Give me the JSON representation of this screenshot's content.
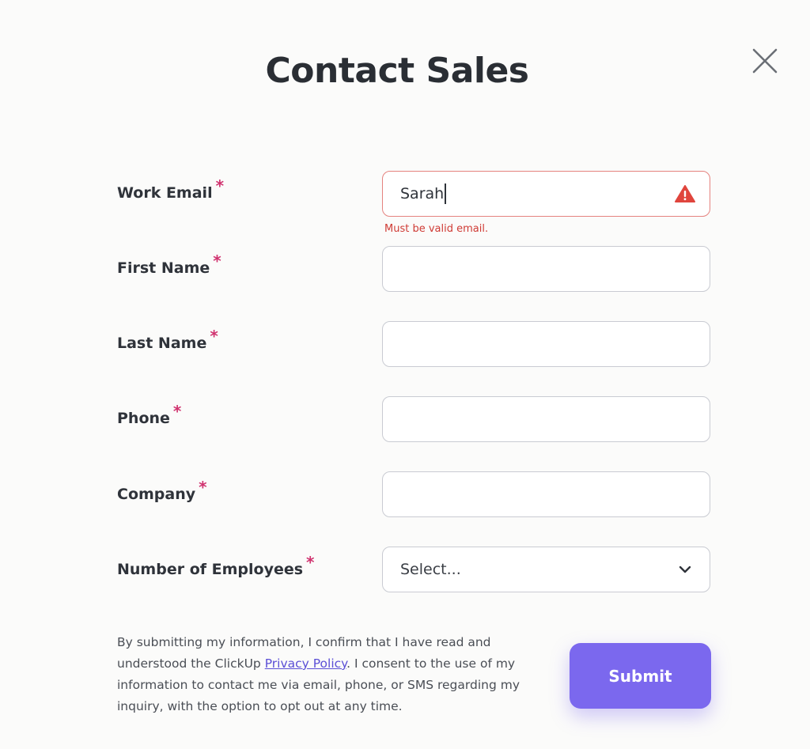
{
  "dialog": {
    "title": "Contact Sales"
  },
  "form": {
    "fields": [
      {
        "label": "Work Email",
        "required_mark": "*",
        "value": "Sarah",
        "error": "Must be valid email."
      },
      {
        "label": "First Name",
        "required_mark": "*",
        "value": ""
      },
      {
        "label": "Last Name",
        "required_mark": "*",
        "value": ""
      },
      {
        "label": "Phone",
        "required_mark": "*",
        "value": ""
      },
      {
        "label": "Company",
        "required_mark": "*",
        "value": ""
      },
      {
        "label": "Number of Employees",
        "required_mark": "*",
        "selected": "Select..."
      }
    ]
  },
  "consent": {
    "text_before": "By submitting my information, I confirm that I have read and understood the ClickUp ",
    "link_text": "Privacy Policy",
    "text_after": ". I consent to the use of my information to contact me via email, phone, or SMS regarding my inquiry, with the option to opt out at any time."
  },
  "actions": {
    "submit_label": "Submit"
  },
  "icons": {
    "close": "close-icon",
    "warning": "warning-icon",
    "dropdown": "chevron-down-icon"
  },
  "colors": {
    "accent": "#7b68ee",
    "required": "#d0336f",
    "error": "#cf3b35",
    "error_border": "#e5837f",
    "link": "#5b4fd6"
  }
}
